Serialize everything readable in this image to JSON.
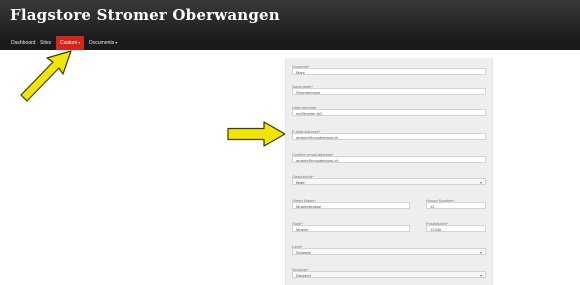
{
  "header": {
    "title": "Flagstore Stromer Oberwangen"
  },
  "nav": {
    "items": [
      {
        "label": "Dashboard"
      },
      {
        "label": "Sites"
      },
      {
        "label": "Custom",
        "caret": "▾"
      },
      {
        "label": "Documents",
        "caret": "▾"
      }
    ]
  },
  "colors": {
    "accent": "#d9241c",
    "arrow_fill": "#f2e600",
    "arrow_stroke": "#3a3a00"
  },
  "form": {
    "fields": [
      {
        "label": "Vorname*",
        "value": "Marc"
      },
      {
        "label": "Nachname*",
        "value": "Stromermann"
      },
      {
        "label": "Unternehmen",
        "value": "myStromer AG"
      },
      {
        "label": "E-Mail Adresse*",
        "value": "mustér@mustemann.ch"
      },
      {
        "label": "Confirm email address*",
        "value": "muster@mustemann.ch"
      },
      {
        "label": "Geschlecht*",
        "value": "Male",
        "type": "select"
      },
      {
        "label": "Street Name*",
        "value": "Musterstrasse"
      },
      {
        "label": "House Number*",
        "value": "12"
      },
      {
        "label": "Stadt*",
        "value": "Muster"
      },
      {
        "label": "Postleitzahl*",
        "value": "12345"
      },
      {
        "label": "Land*",
        "value": "Schweiz",
        "type": "select"
      },
      {
        "label": "Sprache*",
        "value": "Deutsch",
        "type": "select"
      }
    ]
  }
}
